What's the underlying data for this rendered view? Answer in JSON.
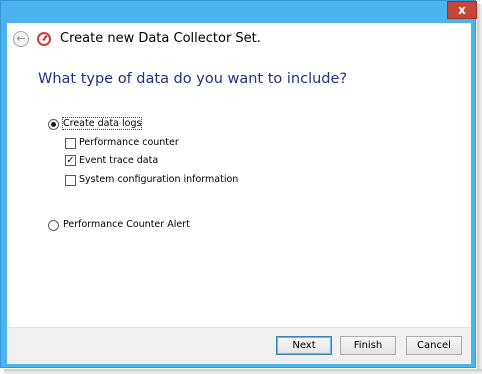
{
  "window": {
    "title": "Create new Data Collector Set.",
    "close_label": "x"
  },
  "main": {
    "heading": "What type of data do you want to include?",
    "options": [
      {
        "label": "Create data logs",
        "selected": true,
        "sub_options": [
          {
            "label": "Performance counter",
            "checked": false
          },
          {
            "label": "Event trace data",
            "checked": true
          },
          {
            "label": "System configuration information",
            "checked": false
          }
        ]
      },
      {
        "label": "Performance Counter Alert",
        "selected": false
      }
    ]
  },
  "footer": {
    "next_label": "Next",
    "finish_label": "Finish",
    "cancel_label": "Cancel"
  },
  "colors": {
    "frame": "#4bb4ec",
    "heading": "#1e3287",
    "close": "#c7463a"
  },
  "icons": {
    "back": "back-arrow-icon",
    "app": "data-collector-icon",
    "close": "close-icon"
  }
}
